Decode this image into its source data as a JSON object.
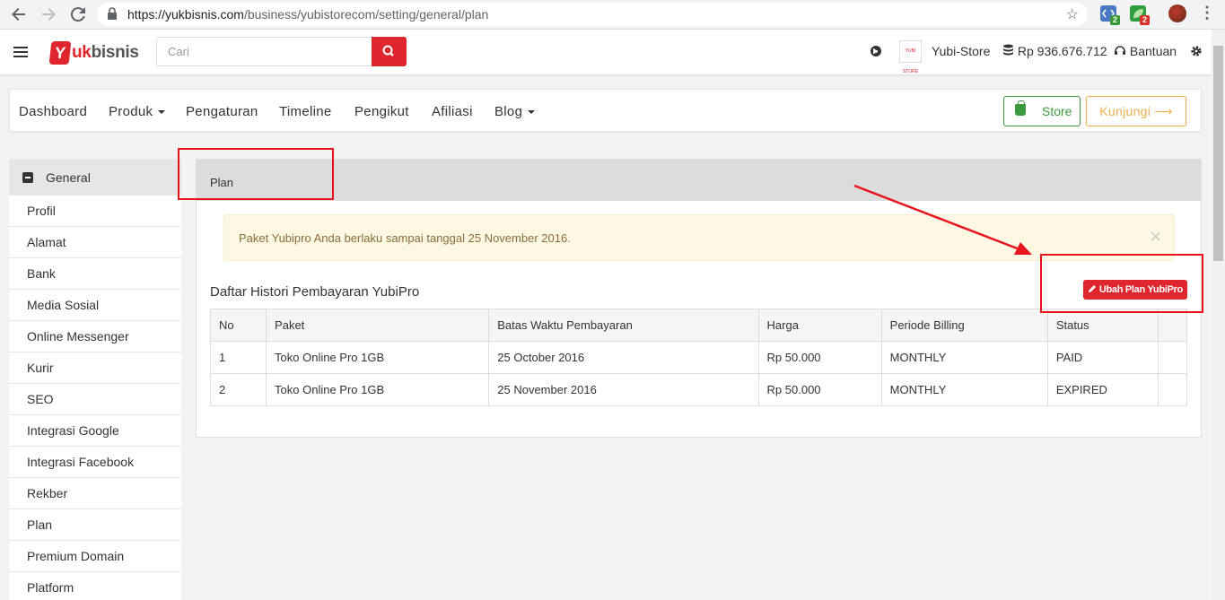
{
  "browser": {
    "url_host": "https://yukbisnis.com",
    "url_path": "/business/yubistorecom/setting/general/plan",
    "ext1_badge": "2",
    "ext2_badge": "2"
  },
  "header": {
    "logo_mark": "Y",
    "logo_red": "uk",
    "logo_rest": "bisnis",
    "search_placeholder": "Cari",
    "store_name": "Yubi-Store",
    "store_logo_text": "YUBI STORE",
    "balance": "Rp 936.676.712",
    "help": "Bantuan"
  },
  "topnav": {
    "items": [
      "Dashboard",
      "Produk",
      "Pengaturan",
      "Timeline",
      "Pengikut",
      "Afiliasi",
      "Blog"
    ],
    "store_btn": "Store",
    "visit_btn": "Kunjungi ⟶"
  },
  "sidebar": {
    "section": "General",
    "links": [
      "Profil",
      "Alamat",
      "Bank",
      "Media Sosial",
      "Online Messenger",
      "Kurir",
      "SEO",
      "Integrasi Google",
      "Integrasi Facebook",
      "Rekber",
      "Plan",
      "Premium Domain",
      "Platform"
    ]
  },
  "panel": {
    "title": "Plan",
    "alert": "Paket Yubipro Anda berlaku sampai tanggal 25 November 2016.",
    "alert_close": "×",
    "history_title": "Daftar Histori Pembayaran YubiPro",
    "change_plan_btn": "Ubah Plan YubiPro",
    "columns": [
      "No",
      "Paket",
      "Batas Waktu Pembayaran",
      "Harga",
      "Periode Billing",
      "Status",
      ""
    ],
    "rows": [
      [
        "1",
        "Toko Online Pro 1GB",
        "25 October 2016",
        "Rp 50.000",
        "MONTHLY",
        "PAID",
        ""
      ],
      [
        "2",
        "Toko Online Pro 1GB",
        "25 November 2016",
        "Rp 50.000",
        "MONTHLY",
        "EXPIRED",
        ""
      ]
    ]
  },
  "colors": {
    "brand_red": "#e0262d",
    "store_green": "#3c9a3c",
    "visit_orange": "#f0ad4e",
    "annotation_red": "#e8141b"
  }
}
